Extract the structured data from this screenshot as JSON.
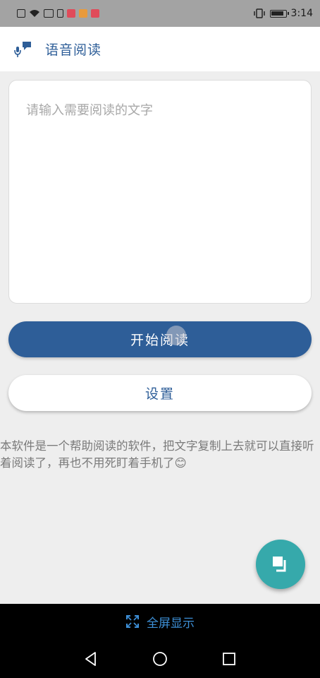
{
  "status_bar": {
    "time": "3:14",
    "icons": [
      "sim-icon",
      "wifi-icon",
      "signal-icon",
      "battery-saver-icon",
      "app-notification-icon",
      "app-notification-icon",
      "app-notification-icon",
      "vibrate-icon",
      "battery-icon"
    ]
  },
  "app_bar": {
    "title": "语音阅读",
    "logo_icon": "mic-speech-icon"
  },
  "input": {
    "placeholder": "请输入需要阅读的文字",
    "value": ""
  },
  "buttons": {
    "start_label": "开始阅读",
    "settings_label": "设置"
  },
  "description": "本软件是一个帮助阅读的软件，把文字复制上去就可以直接听着阅读了，再也不用死盯着手机了😊",
  "fab": {
    "icon": "copy-icon"
  },
  "fullscreen": {
    "label": "全屏显示",
    "icon": "expand-icon"
  },
  "nav": {
    "back_icon": "back-triangle-icon",
    "home_icon": "home-circle-icon",
    "recents_icon": "recents-square-icon"
  },
  "colors": {
    "primary": "#2e5e98",
    "fab": "#36a9ab",
    "background": "#eeeeee",
    "status_bar": "#a3a3a3",
    "fullscreen_text": "#3d8fd6"
  }
}
